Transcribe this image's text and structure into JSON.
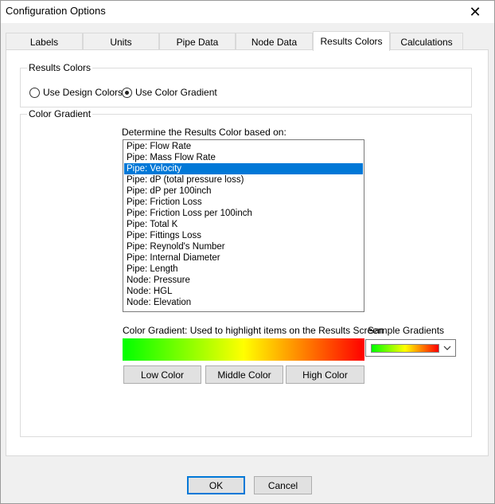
{
  "window": {
    "title": "Configuration Options",
    "close_glyph": "✕"
  },
  "tabs": [
    {
      "label": "Labels"
    },
    {
      "label": "Units"
    },
    {
      "label": "Pipe Data"
    },
    {
      "label": "Node Data"
    },
    {
      "label": "Results Colors"
    },
    {
      "label": "Calculations"
    }
  ],
  "results_colors": {
    "group_label": "Results Colors",
    "option_design": "Use Design Colors",
    "option_gradient": "Use Color Gradient",
    "selected_option": "gradient"
  },
  "color_gradient": {
    "group_label": "Color Gradient",
    "list_prompt": "Determine the Results Color based on:",
    "items": [
      "Pipe: Flow Rate",
      "Pipe: Mass Flow Rate",
      "Pipe: Velocity",
      "Pipe: dP (total pressure loss)",
      "Pipe: dP per 100inch",
      "Pipe: Friction Loss",
      "Pipe: Friction Loss per 100inch",
      "Pipe: Total K",
      "Pipe: Fittings Loss",
      "Pipe: Reynold's Number",
      "Pipe: Internal Diameter",
      "Pipe: Length",
      "Node: Pressure",
      "Node: HGL",
      "Node: Elevation"
    ],
    "selected_item": "Pipe: Velocity",
    "gradient_caption": "Color Gradient: Used to highlight items on the Results Screen",
    "sample_label": "Sample Gradients",
    "gradient_colors": [
      "#00ff00",
      "#ffff00",
      "#ff0000"
    ],
    "low_button": "Low Color",
    "middle_button": "Middle Color",
    "high_button": "High Color"
  },
  "footer": {
    "ok": "OK",
    "cancel": "Cancel"
  },
  "colors": {
    "selection": "#0078d7",
    "default_button_border": "#0078d7"
  }
}
